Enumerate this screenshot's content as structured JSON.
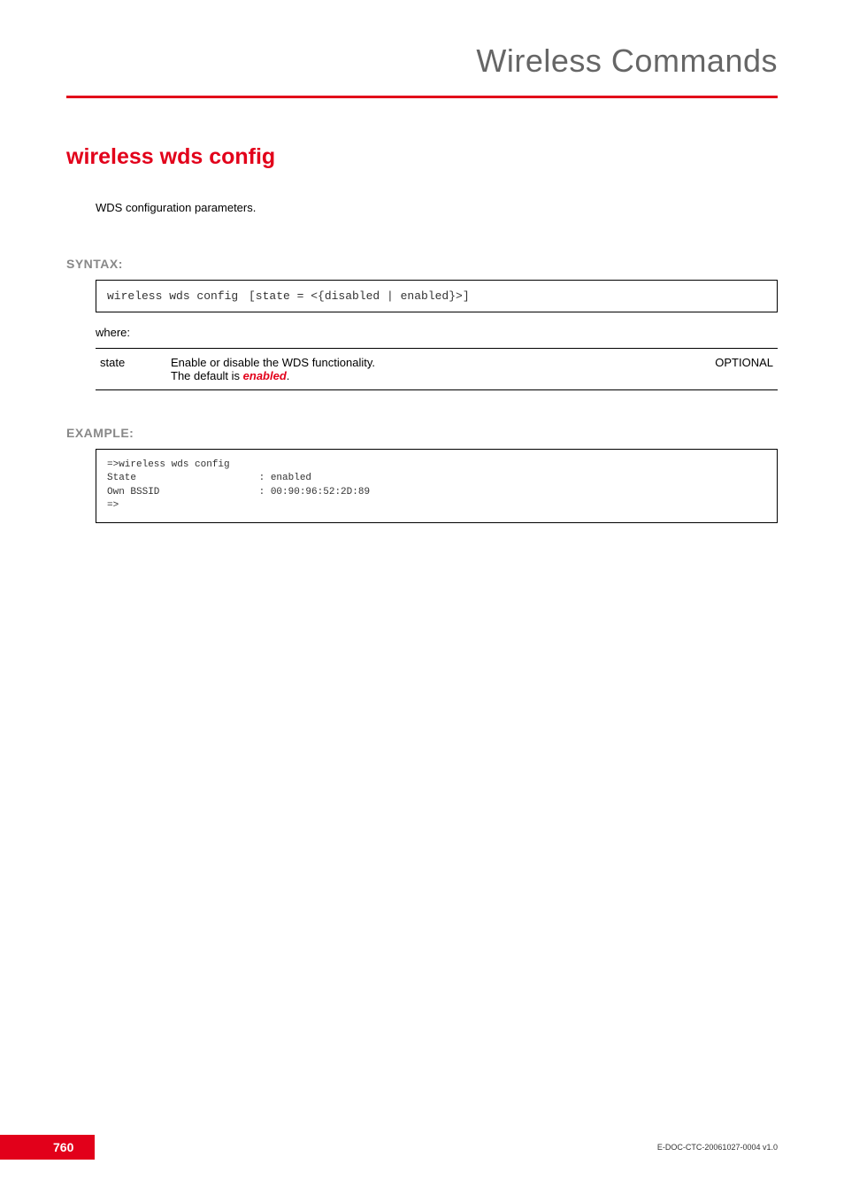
{
  "header": {
    "title": "Wireless Commands"
  },
  "command": {
    "title": "wireless wds config",
    "description": "WDS configuration parameters."
  },
  "syntax": {
    "label": "SYNTAX:",
    "command": "wireless wds config",
    "args": "[state = <{disabled | enabled}>]"
  },
  "where_label": "where:",
  "param": {
    "name": "state",
    "desc_line1": "Enable or disable the WDS functionality.",
    "desc_line2_prefix": "The default is ",
    "desc_line2_em": "enabled",
    "desc_line2_suffix": ".",
    "required": "OPTIONAL"
  },
  "example": {
    "label": "EXAMPLE:",
    "line1": "=>wireless wds config",
    "line2": "State                     : enabled",
    "line3": "Own BSSID                 : 00:90:96:52:2D:89",
    "line4": "=>"
  },
  "footer": {
    "page_num": "760",
    "doc_id": "E-DOC-CTC-20061027-0004 v1.0"
  }
}
